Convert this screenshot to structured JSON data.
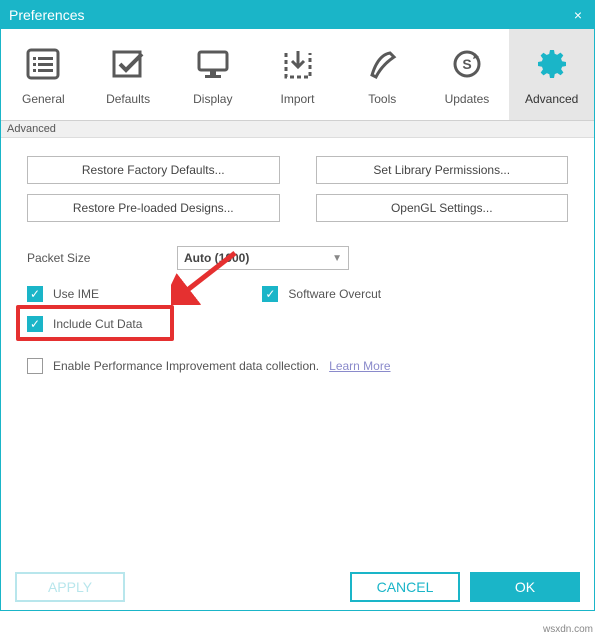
{
  "titlebar": {
    "title": "Preferences",
    "close": "×"
  },
  "tabs": {
    "items": [
      {
        "label": "General"
      },
      {
        "label": "Defaults"
      },
      {
        "label": "Display"
      },
      {
        "label": "Import"
      },
      {
        "label": "Tools"
      },
      {
        "label": "Updates"
      },
      {
        "label": "Advanced"
      }
    ]
  },
  "section": {
    "header": "Advanced"
  },
  "buttons": {
    "restore_factory": "Restore Factory Defaults...",
    "set_library": "Set Library Permissions...",
    "restore_designs": "Restore Pre-loaded Designs...",
    "opengl": "OpenGL Settings..."
  },
  "packet": {
    "label": "Packet Size",
    "value": "Auto (1000)"
  },
  "checks": {
    "use_ime": "Use IME",
    "include_cut": "Include Cut Data",
    "overcut": "Software Overcut",
    "perf": "Enable Performance Improvement data collection.",
    "learn_more": "Learn More"
  },
  "footer": {
    "apply": "APPLY",
    "cancel": "CANCEL",
    "ok": "OK"
  },
  "watermark": "wsxdn.com"
}
